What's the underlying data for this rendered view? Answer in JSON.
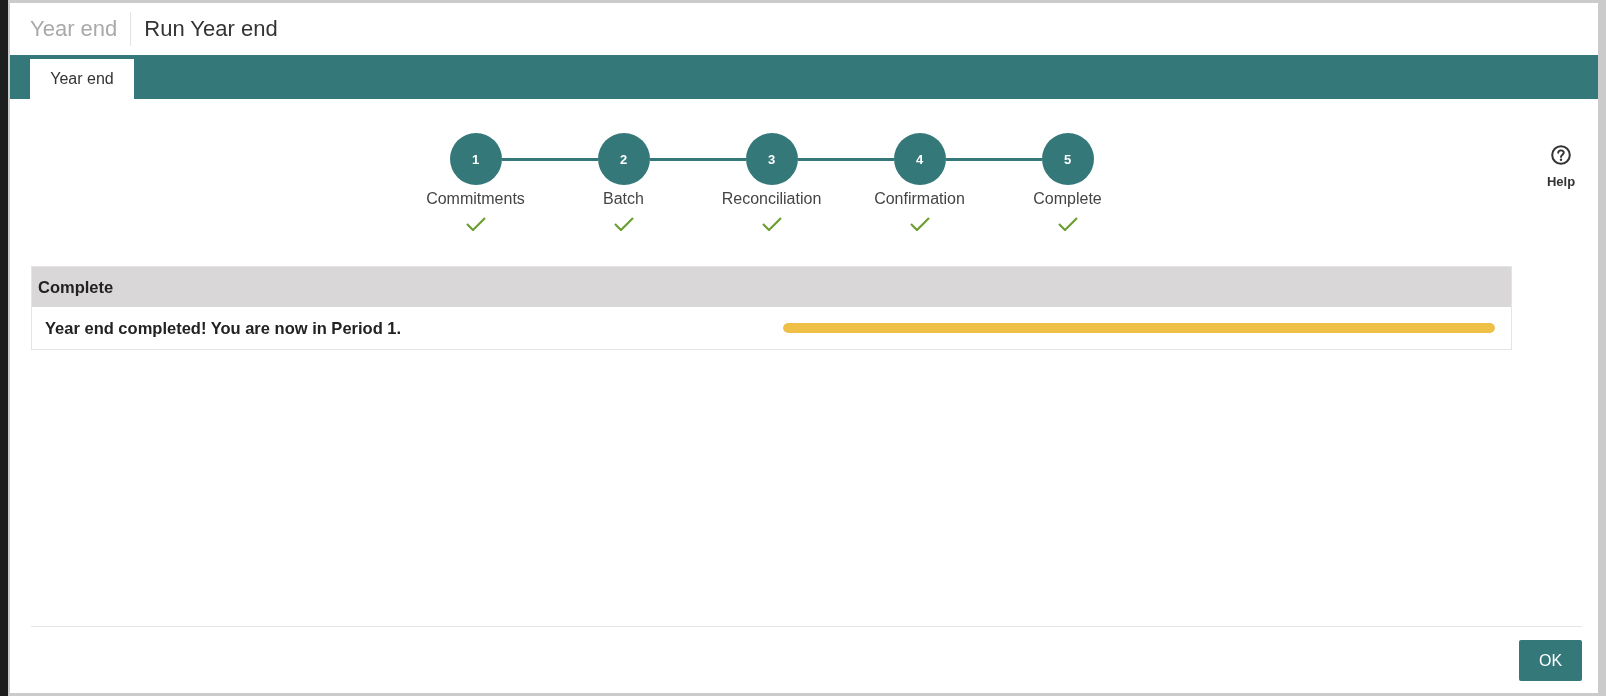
{
  "window": {
    "breadcrumb": "Year end",
    "title": "Run Year end"
  },
  "tabs": [
    {
      "label": "Year end",
      "selected": true
    }
  ],
  "steps": [
    {
      "number": "1",
      "label": "Commitments",
      "completed": true
    },
    {
      "number": "2",
      "label": "Batch",
      "completed": true
    },
    {
      "number": "3",
      "label": "Reconciliation",
      "completed": true
    },
    {
      "number": "4",
      "label": "Confirmation",
      "completed": true
    },
    {
      "number": "5",
      "label": "Complete",
      "completed": true
    }
  ],
  "help": {
    "label": "Help"
  },
  "panel": {
    "title": "Complete",
    "message": "Year end completed! You are now in Period 1.",
    "progress": {
      "level": 1
    }
  },
  "buttons": [
    {
      "label": "OK"
    }
  ]
}
